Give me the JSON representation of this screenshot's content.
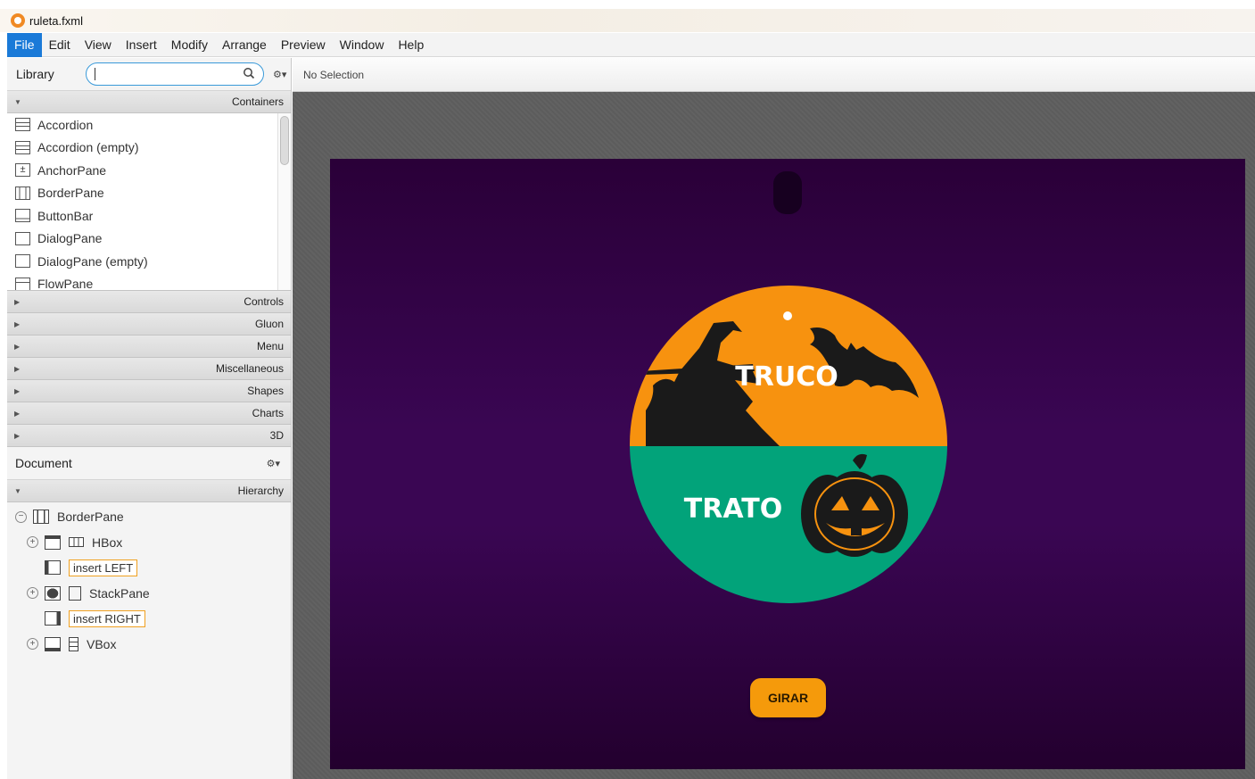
{
  "window": {
    "title": "ruleta.fxml"
  },
  "menubar": {
    "items": [
      "File",
      "Edit",
      "View",
      "Insert",
      "Modify",
      "Arrange",
      "Preview",
      "Window",
      "Help"
    ],
    "active": "File"
  },
  "library": {
    "label": "Library",
    "search_value": "",
    "sections": {
      "containers": "Containers"
    },
    "container_items": [
      "Accordion",
      "Accordion  (empty)",
      "AnchorPane",
      "BorderPane",
      "ButtonBar",
      "DialogPane",
      "DialogPane  (empty)",
      "FlowPane"
    ],
    "collapsed_sections": [
      "Controls",
      "Gluon",
      "Menu",
      "Miscellaneous",
      "Shapes",
      "Charts",
      "3D"
    ]
  },
  "document": {
    "label": "Document",
    "hierarchy_label": "Hierarchy",
    "tree": {
      "root": "BorderPane",
      "hbox": "HBox",
      "insert_left": "insert LEFT",
      "stackpane": "StackPane",
      "insert_right": "insert RIGHT",
      "vbox": "VBox"
    }
  },
  "editor": {
    "selection_status": "No Selection"
  },
  "roulette": {
    "top_label": "TRUCO",
    "bottom_label": "TRATO",
    "top_color": "#f7920f",
    "bottom_color": "#02a37a"
  },
  "spin_button": {
    "label": "GIRAR",
    "color": "#f59a0b"
  },
  "colors": {
    "accent": "#1a7ad8",
    "stage_bg": "#3a0653"
  }
}
